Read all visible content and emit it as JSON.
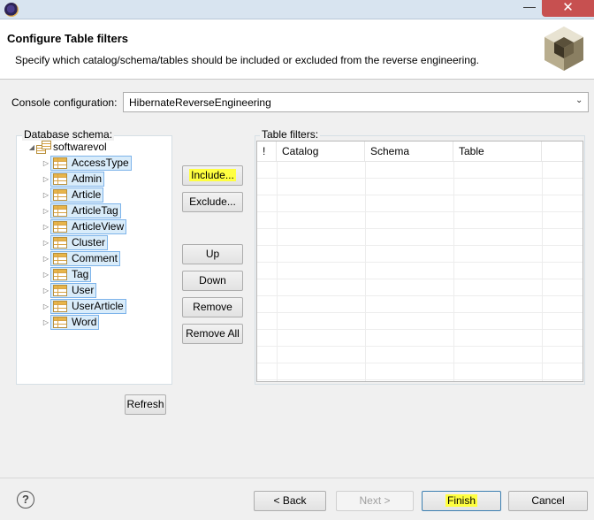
{
  "window": {
    "minimize_glyph": "—",
    "close_glyph": "✕"
  },
  "header": {
    "title": "Configure Table filters",
    "description": "Specify which catalog/schema/tables should be included or excluded from the reverse engineering."
  },
  "console": {
    "label": "Console configuration:",
    "selected": "HibernateReverseEngineering"
  },
  "schema_panel": {
    "label": "Database schema:",
    "root": "softwarevol",
    "tables": [
      "AccessType",
      "Admin",
      "Article",
      "ArticleTag",
      "ArticleView",
      "Cluster",
      "Comment",
      "Tag",
      "User",
      "UserArticle",
      "Word"
    ],
    "refresh_label": "Refresh"
  },
  "actions": {
    "include": "Include...",
    "exclude": "Exclude...",
    "up": "Up",
    "down": "Down",
    "remove": "Remove",
    "remove_all": "Remove All"
  },
  "filters_panel": {
    "label": "Table filters:",
    "columns": [
      "!",
      "Catalog",
      "Schema",
      "Table"
    ]
  },
  "footer": {
    "help_glyph": "?",
    "back": "< Back",
    "next": "Next >",
    "finish": "Finish",
    "cancel": "Cancel"
  },
  "colors": {
    "highlight": "#ffff40",
    "selection_bg": "#d9ecfa",
    "selection_border": "#7eb4ea",
    "close_button": "#c75050"
  }
}
